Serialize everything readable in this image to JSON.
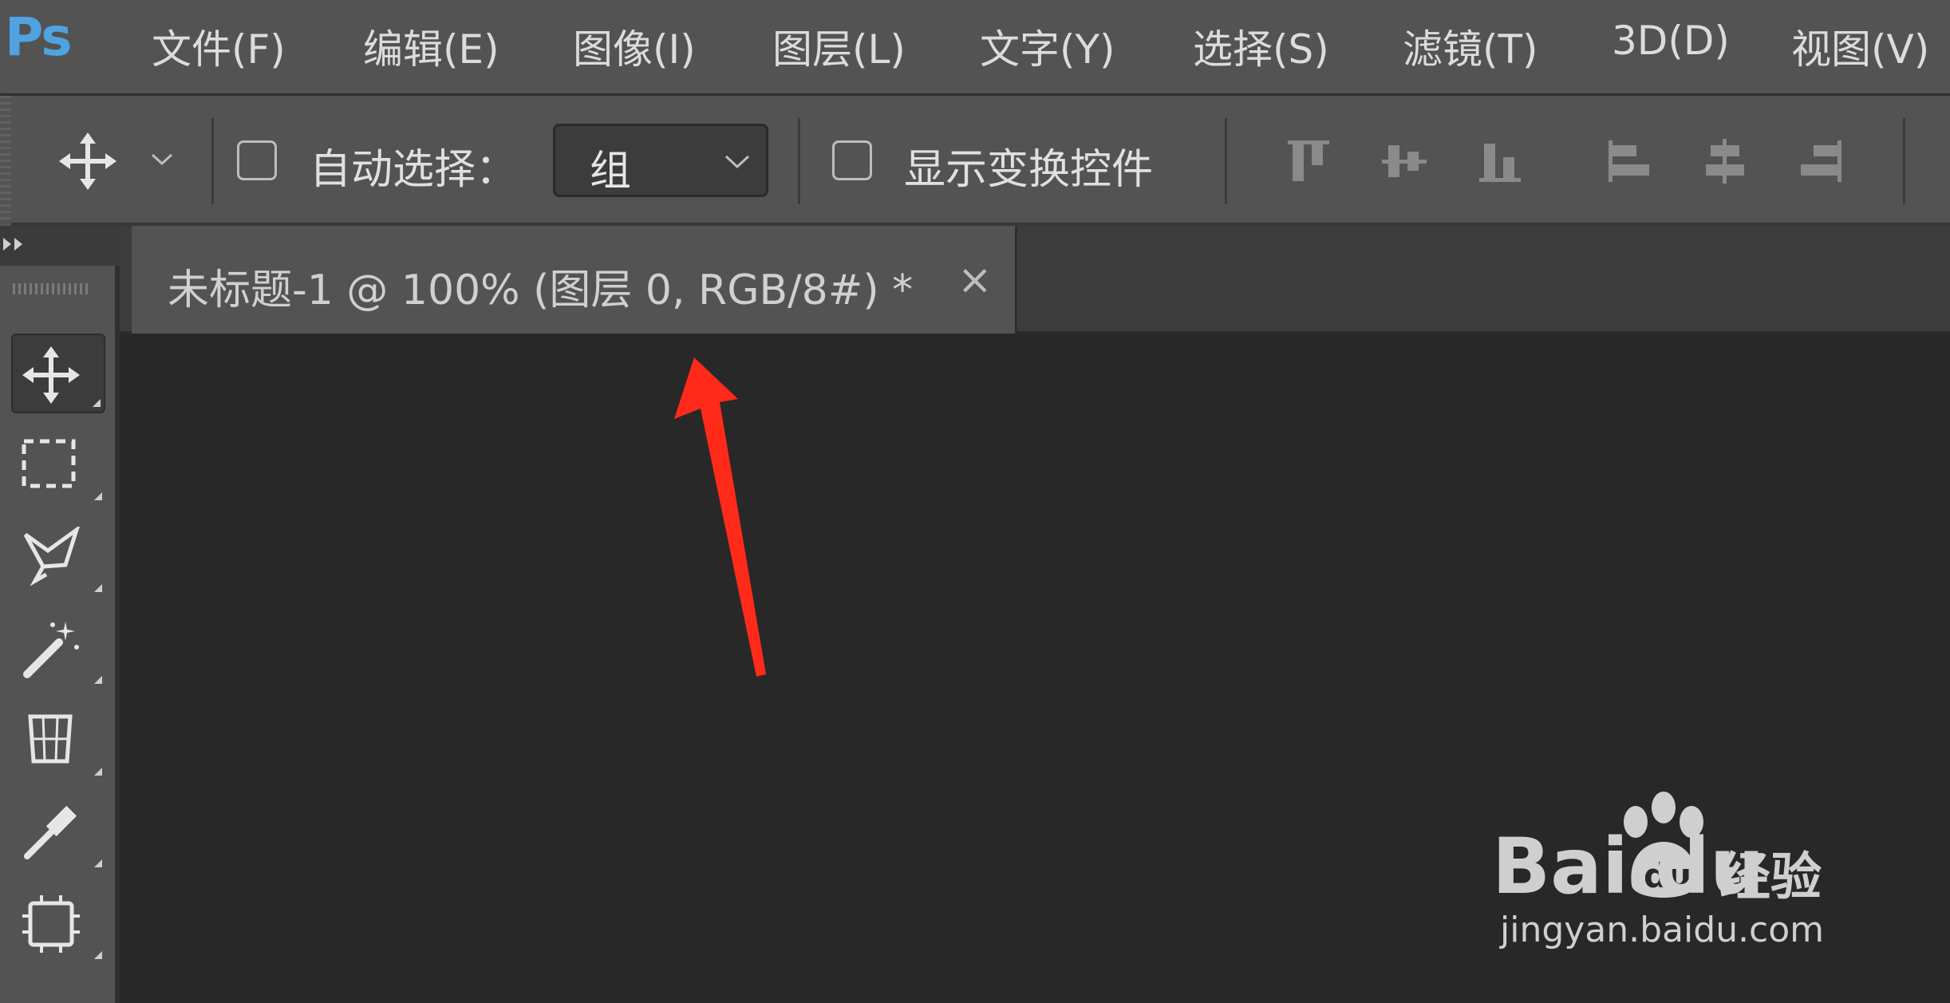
{
  "app": {
    "logo": "Ps"
  },
  "menu": [
    {
      "label": "文件(F)"
    },
    {
      "label": "编辑(E)"
    },
    {
      "label": "图像(I)"
    },
    {
      "label": "图层(L)"
    },
    {
      "label": "文字(Y)"
    },
    {
      "label": "选择(S)"
    },
    {
      "label": "滤镜(T)"
    },
    {
      "label": "3D(D)"
    },
    {
      "label": "视图(V)"
    }
  ],
  "options": {
    "auto_select_label": "自动选择：",
    "auto_select_checked": false,
    "group_value": "组",
    "show_transform_label": "显示变换控件",
    "show_transform_checked": false,
    "align_icons": [
      "align-top-icon",
      "align-vertical-center-icon",
      "align-bottom-icon",
      "align-left-icon",
      "align-horizontal-center-icon",
      "align-right-icon"
    ]
  },
  "toolbar": {
    "tools": [
      "move-tool-icon",
      "rect-marquee-tool-icon",
      "lasso-tool-icon",
      "magic-wand-tool-icon",
      "perspective-crop-tool-icon",
      "eyedropper-tool-icon",
      "frame-tool-icon"
    ],
    "active": "move-tool-icon"
  },
  "document": {
    "tab_title": "未标题-1 @ 100% (图层 0, RGB/8#) *",
    "close_symbol": "×"
  },
  "annotation": {
    "arrow_color": "#ff2a1a"
  },
  "watermark": {
    "brand": "Bai du",
    "brand_cn": "经验",
    "url": "jingyan.baidu.com"
  },
  "colors": {
    "ui_gray": "#535353",
    "canvas": "#282828",
    "ps_blue": "#4fa3e0"
  }
}
